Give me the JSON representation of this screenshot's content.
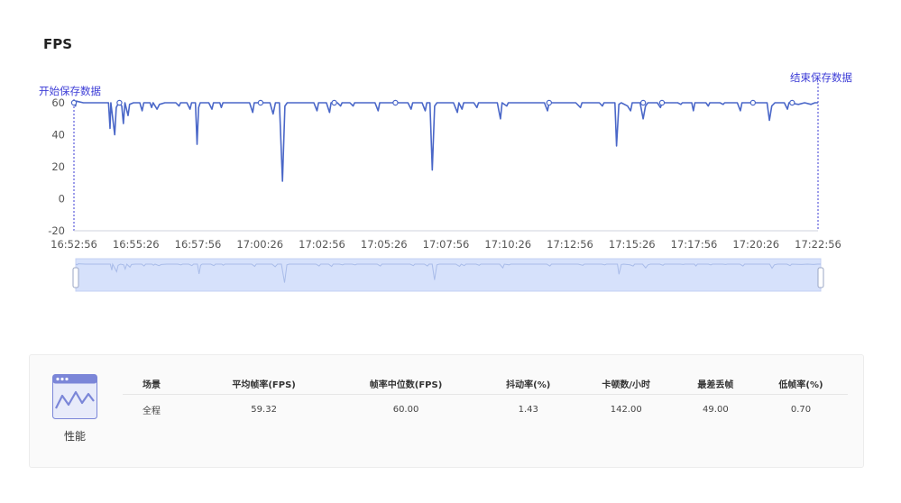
{
  "title": "FPS",
  "markers": {
    "start_label": "开始保存数据",
    "end_label": "结束保存数据"
  },
  "colors": {
    "line": "#4a67c8",
    "marker": "#3b3bd6",
    "slider_fill": "#d6e1fb"
  },
  "chart_data": {
    "type": "line",
    "title": "FPS",
    "xlabel": "",
    "ylabel": "",
    "ylim": [
      -20,
      60
    ],
    "y_ticks": [
      60,
      40,
      20,
      0,
      -20
    ],
    "x_ticks": [
      "16:52:56",
      "16:55:26",
      "16:57:56",
      "17:00:26",
      "17:02:56",
      "17:05:26",
      "17:07:56",
      "17:10:26",
      "17:12:56",
      "17:15:26",
      "17:17:56",
      "17:20:26",
      "17:22:56"
    ],
    "x_unit": "minutes since 16:52:56",
    "grid": false,
    "series": [
      {
        "name": "FPS",
        "points": [
          [
            0,
            60
          ],
          [
            0.1,
            58
          ],
          [
            0.15,
            61
          ],
          [
            0.6,
            60
          ],
          [
            1.5,
            60
          ],
          [
            2.2,
            60
          ],
          [
            2.3,
            44
          ],
          [
            2.35,
            60
          ],
          [
            2.6,
            40
          ],
          [
            2.7,
            57
          ],
          [
            2.85,
            60
          ],
          [
            3.05,
            58
          ],
          [
            3.15,
            47
          ],
          [
            3.25,
            60
          ],
          [
            3.45,
            52
          ],
          [
            3.55,
            59
          ],
          [
            3.8,
            60
          ],
          [
            4.2,
            60
          ],
          [
            4.35,
            55
          ],
          [
            4.45,
            60
          ],
          [
            4.85,
            60
          ],
          [
            4.95,
            57
          ],
          [
            5.05,
            60
          ],
          [
            5.3,
            56
          ],
          [
            5.45,
            59
          ],
          [
            5.8,
            60
          ],
          [
            6.5,
            60
          ],
          [
            6.7,
            58
          ],
          [
            6.8,
            60
          ],
          [
            7.2,
            60
          ],
          [
            7.4,
            56
          ],
          [
            7.5,
            60
          ],
          [
            7.75,
            60
          ],
          [
            7.85,
            34
          ],
          [
            7.95,
            57
          ],
          [
            8.05,
            60
          ],
          [
            8.6,
            60
          ],
          [
            8.8,
            56
          ],
          [
            8.9,
            60
          ],
          [
            9.3,
            60
          ],
          [
            9.4,
            57
          ],
          [
            9.5,
            60
          ],
          [
            11.2,
            60
          ],
          [
            11.4,
            54
          ],
          [
            11.5,
            60
          ],
          [
            12.5,
            60
          ],
          [
            12.7,
            53
          ],
          [
            12.85,
            60
          ],
          [
            13.1,
            60
          ],
          [
            13.3,
            11
          ],
          [
            13.45,
            58
          ],
          [
            13.6,
            60
          ],
          [
            15.3,
            60
          ],
          [
            15.5,
            55
          ],
          [
            15.6,
            60
          ],
          [
            16.1,
            60
          ],
          [
            16.3,
            54
          ],
          [
            16.4,
            60
          ],
          [
            16.8,
            60
          ],
          [
            17.0,
            58
          ],
          [
            17.1,
            60
          ],
          [
            17.6,
            60
          ],
          [
            17.8,
            58
          ],
          [
            17.9,
            60
          ],
          [
            19.2,
            60
          ],
          [
            19.4,
            55
          ],
          [
            19.5,
            60
          ],
          [
            21.3,
            60
          ],
          [
            21.5,
            56
          ],
          [
            21.6,
            60
          ],
          [
            22.2,
            60
          ],
          [
            22.4,
            55
          ],
          [
            22.5,
            60
          ],
          [
            22.7,
            60
          ],
          [
            22.85,
            18
          ],
          [
            23.0,
            58
          ],
          [
            23.15,
            60
          ],
          [
            24.2,
            60
          ],
          [
            24.45,
            54
          ],
          [
            24.55,
            60
          ],
          [
            24.75,
            56
          ],
          [
            24.85,
            60
          ],
          [
            25.5,
            60
          ],
          [
            25.7,
            57
          ],
          [
            25.8,
            60
          ],
          [
            27.0,
            60
          ],
          [
            27.2,
            50
          ],
          [
            27.3,
            60
          ],
          [
            27.6,
            58
          ],
          [
            27.7,
            60
          ],
          [
            30.0,
            60
          ],
          [
            30.2,
            55
          ],
          [
            30.3,
            60
          ],
          [
            32.0,
            60
          ],
          [
            32.3,
            57
          ],
          [
            32.4,
            60
          ],
          [
            33.5,
            60
          ],
          [
            33.7,
            58
          ],
          [
            33.8,
            60
          ],
          [
            34.5,
            60
          ],
          [
            34.6,
            33
          ],
          [
            34.75,
            59
          ],
          [
            34.9,
            60
          ],
          [
            35.3,
            58
          ],
          [
            35.5,
            55
          ],
          [
            35.6,
            60
          ],
          [
            36.1,
            60
          ],
          [
            36.3,
            50
          ],
          [
            36.45,
            58
          ],
          [
            36.6,
            60
          ],
          [
            37.2,
            60
          ],
          [
            37.4,
            57
          ],
          [
            37.5,
            60
          ],
          [
            38.5,
            60
          ],
          [
            38.7,
            59
          ],
          [
            38.8,
            60
          ],
          [
            39.4,
            60
          ],
          [
            39.5,
            55
          ],
          [
            39.6,
            60
          ],
          [
            40.3,
            60
          ],
          [
            40.45,
            58
          ],
          [
            40.55,
            60
          ],
          [
            41.2,
            60
          ],
          [
            41.4,
            59
          ],
          [
            41.5,
            60
          ],
          [
            42.3,
            60
          ],
          [
            42.5,
            55
          ],
          [
            42.6,
            60
          ],
          [
            43.2,
            60
          ],
          [
            44.2,
            60
          ],
          [
            44.35,
            49
          ],
          [
            44.5,
            58
          ],
          [
            44.7,
            60
          ],
          [
            45.3,
            60
          ],
          [
            45.5,
            56
          ],
          [
            45.6,
            60
          ],
          [
            46.2,
            59
          ],
          [
            46.6,
            60
          ],
          [
            47.0,
            59
          ],
          [
            47.25,
            60
          ],
          [
            47.45,
            60
          ]
        ],
        "circle_markers": [
          [
            0,
            60
          ],
          [
            2.9,
            60
          ],
          [
            11.9,
            60
          ],
          [
            16.6,
            60
          ],
          [
            20.5,
            60
          ],
          [
            30.3,
            60
          ],
          [
            36.3,
            60
          ],
          [
            37.5,
            60
          ],
          [
            43.3,
            60
          ],
          [
            45.8,
            60
          ]
        ]
      }
    ]
  },
  "slider": {
    "start_handle": "left-handle",
    "end_handle": "right-handle"
  },
  "stats": {
    "label": "性能",
    "headers": [
      "场景",
      "平均帧率(FPS)",
      "帧率中位数(FPS)",
      "抖动率(%)",
      "卡顿数/小时",
      "最差丢帧",
      "低帧率(%)"
    ],
    "row": [
      "全程",
      "59.32",
      "60.00",
      "1.43",
      "142.00",
      "49.00",
      "0.70"
    ]
  }
}
